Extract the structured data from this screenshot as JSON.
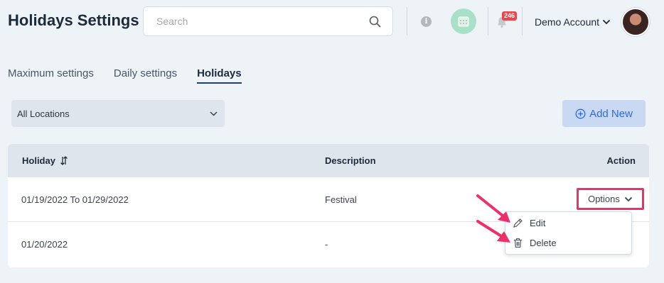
{
  "header": {
    "title": "Holidays Settings",
    "search_placeholder": "Search",
    "notification_count": "246",
    "account_name": "Demo Account"
  },
  "tabs": [
    {
      "label": "Maximum settings",
      "active": false
    },
    {
      "label": "Daily settings",
      "active": false
    },
    {
      "label": "Holidays",
      "active": true
    }
  ],
  "filters": {
    "location_selected": "All Locations"
  },
  "toolbar": {
    "add_label": "Add New"
  },
  "table": {
    "columns": [
      "Holiday",
      "Description",
      "Action"
    ],
    "rows": [
      {
        "date": "01/19/2022 To 01/29/2022",
        "description": "Festival"
      },
      {
        "date": "01/20/2022",
        "description": "-"
      }
    ]
  },
  "options_menu": {
    "button_label": "Options",
    "items": [
      {
        "label": "Edit",
        "icon": "pencil-icon"
      },
      {
        "label": "Delete",
        "icon": "trash-icon"
      }
    ]
  },
  "colors": {
    "accent": "#2f6be0",
    "highlight": "#ee2f6a",
    "badge": "#e5484d",
    "calendar_button": "#a8e0c8"
  }
}
